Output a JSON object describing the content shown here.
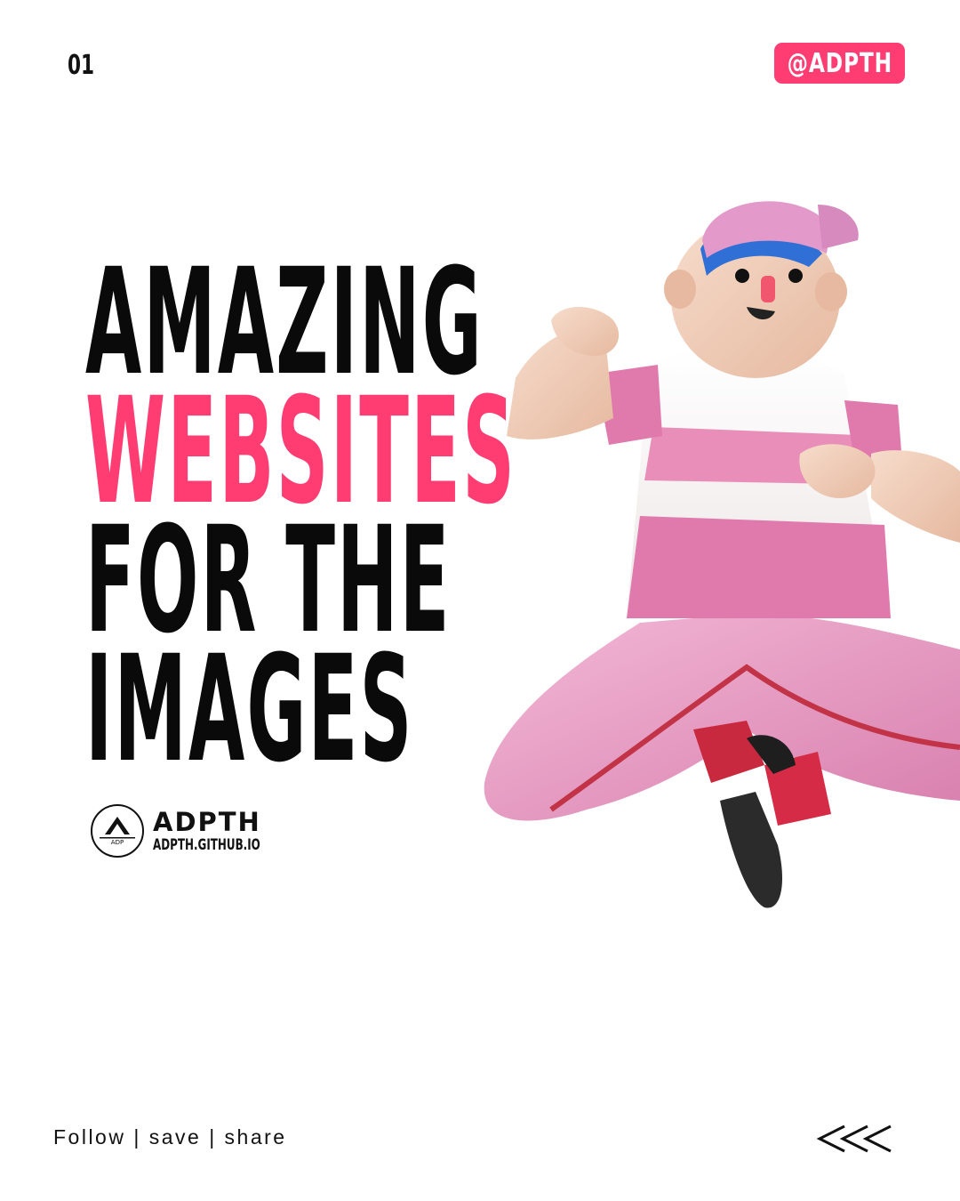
{
  "header": {
    "page_number": "01",
    "handle": "@ADPTH"
  },
  "headline": {
    "line1": "AMAZING",
    "line2": "WEBSITES",
    "line3": "FOR THE",
    "line4": "IMAGES"
  },
  "brand": {
    "name": "ADPTH",
    "url": "ADPTH.GITHUB.IO",
    "logo_text": "ADP"
  },
  "footer": {
    "call_to_action": "Follow | save | share",
    "swipe_icon": "triple-chevron-left-icon"
  },
  "colors": {
    "accent": "#ff3d73",
    "text": "#0a0a0a",
    "background": "#ffffff"
  }
}
